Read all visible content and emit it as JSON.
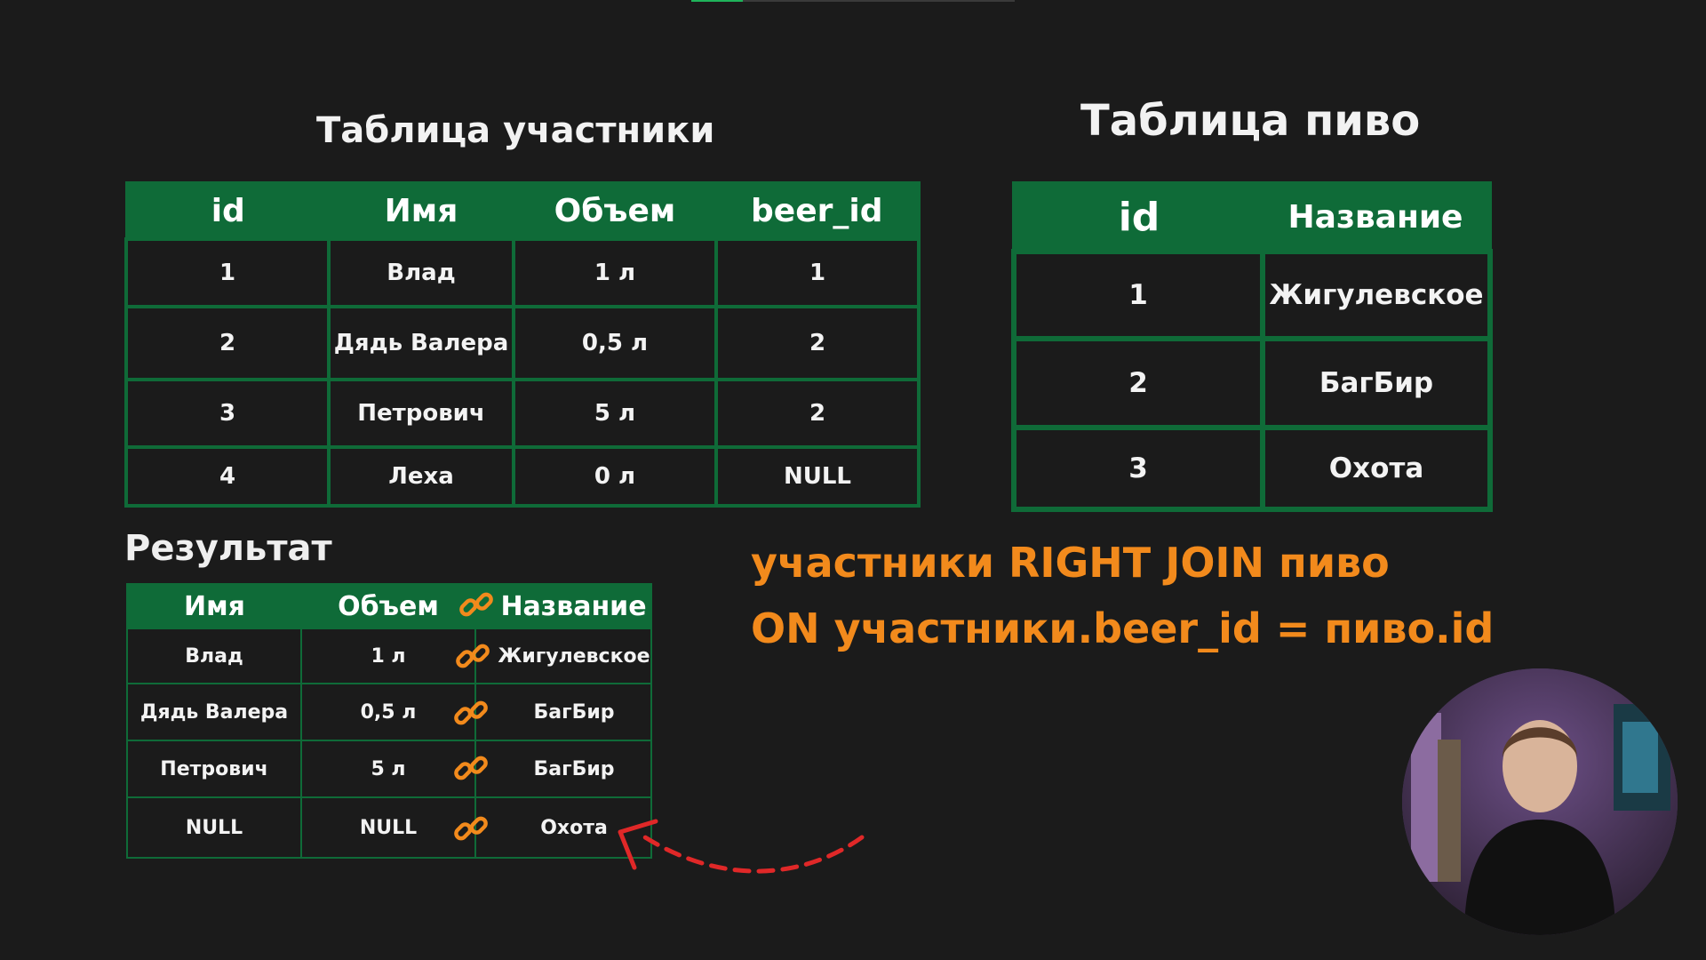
{
  "progress": {
    "fraction": 0.16
  },
  "participants": {
    "title": "Таблица участники",
    "headers": [
      "id",
      "Имя",
      "Объем",
      "beer_id"
    ],
    "rows": [
      [
        "1",
        "Влад",
        "1 л",
        "1"
      ],
      [
        "2",
        "Дядь Валера",
        "0,5 л",
        "2"
      ],
      [
        "3",
        "Петрович",
        "5 л",
        "2"
      ],
      [
        "4",
        "Леха",
        "0 л",
        "NULL"
      ]
    ]
  },
  "beer": {
    "title": "Таблица пиво",
    "headers": [
      "id",
      "Название"
    ],
    "rows": [
      [
        "1",
        "Жигулевское"
      ],
      [
        "2",
        "БагБир"
      ],
      [
        "3",
        "Охота"
      ]
    ]
  },
  "result": {
    "title": "Результат",
    "headers": [
      "Имя",
      "Объем",
      "Название"
    ],
    "rows": [
      [
        "Влад",
        "1 л",
        "Жигулевское"
      ],
      [
        "Дядь Валера",
        "0,5 л",
        "БагБир"
      ],
      [
        "Петрович",
        "5 л",
        "БагБир"
      ],
      [
        "NULL",
        "NULL",
        "Охота"
      ]
    ]
  },
  "query": {
    "line1": "участники RIGHT JOIN пиво",
    "line2": "ON участники.beer_id = пиво.id"
  },
  "icons": {
    "link": "link-icon",
    "arrow": "dashed-arrow-icon",
    "webcam": "presenter-webcam"
  },
  "colors": {
    "background": "#1b1b1b",
    "table_green": "#0f6b38",
    "accent_orange": "#f28a1c",
    "progress_green": "#1fb35a"
  }
}
